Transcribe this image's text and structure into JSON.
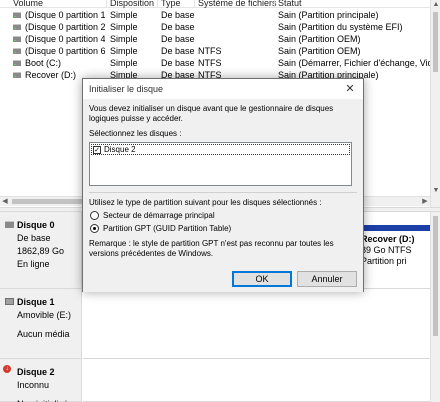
{
  "columns": {
    "volume": "Volume",
    "layout": "Disposition",
    "type": "Type",
    "fs": "Système de fichiers",
    "status": "Statut"
  },
  "volumes": [
    {
      "name": "(Disque 0 partition 1)",
      "layout": "Simple",
      "type": "De base",
      "fs": "",
      "status": "Sain (Partition principale)"
    },
    {
      "name": "(Disque 0 partition 2)",
      "layout": "Simple",
      "type": "De base",
      "fs": "",
      "status": "Sain (Partition du système EFI)"
    },
    {
      "name": "(Disque 0 partition 4)",
      "layout": "Simple",
      "type": "De base",
      "fs": "",
      "status": "Sain (Partition OEM)"
    },
    {
      "name": "(Disque 0 partition 6)",
      "layout": "Simple",
      "type": "De base",
      "fs": "NTFS",
      "status": "Sain (Partition OEM)"
    },
    {
      "name": "Boot (C:)",
      "layout": "Simple",
      "type": "De base",
      "fs": "NTFS",
      "status": "Sain (Démarrer, Fichier d'échange, Vidage"
    },
    {
      "name": "Recover (D:)",
      "layout": "Simple",
      "type": "De base",
      "fs": "NTFS",
      "status": "Sain (Partition principale)"
    }
  ],
  "disks": {
    "disk0": {
      "name": "Disque 0",
      "type": "De base",
      "size": "1862,89 Go",
      "state": "En ligne"
    },
    "disk1": {
      "name": "Disque 1",
      "type": "Amovible (E:)",
      "media": "Aucun média"
    },
    "disk2": {
      "name": "Disque 2",
      "type": "Inconnu",
      "state": "Non initialisé"
    }
  },
  "recover_partition": {
    "name": "Recover (D:)",
    "size": "89 Go NTFS",
    "status": "Partition pri"
  },
  "dialog": {
    "title": "Initialiser le disque",
    "close_glyph": "✕",
    "intro": "Vous devez initialiser un disque avant que le gestionnaire de disques logiques puisse y accéder.",
    "select_label": "Sélectionnez les disques :",
    "disk_item": "Disque 2",
    "disk_checked": true,
    "partition_style_label": "Utilisez le type de partition suivant pour les disques sélectionnés :",
    "option_mbr": "Secteur de démarrage principal",
    "option_gpt": "Partition GPT (GUID Partition Table)",
    "selected_option": "gpt",
    "remark": "Remarque : le style de partition GPT n'est pas reconnu par toutes les versions précédentes de Windows.",
    "ok_label": "OK",
    "cancel_label": "Annuler"
  },
  "colors": {
    "primary_partition_bar": "#1c3fa8",
    "default_button_border": "#0078d7",
    "error_badge": "#d43b2f"
  }
}
